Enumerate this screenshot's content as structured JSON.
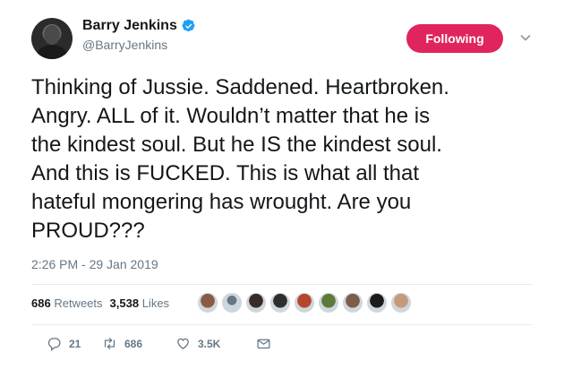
{
  "author": {
    "name": "Barry Jenkins",
    "handle": "@BarryJenkins",
    "verified_icon": "verified-badge-icon"
  },
  "follow_button": {
    "label": "Following",
    "color": "#e0245e"
  },
  "tweet": {
    "text": "Thinking of Jussie. Saddened. Heartbroken.\nAngry. ALL of it. Wouldn’t matter that he is\nthe kindest soul. But he IS the kindest soul.\nAnd this is FUCKED. This is what all that\nhateful mongering has wrought. Are you\nPROUD???",
    "timestamp": "2:26 PM - 29 Jan 2019"
  },
  "stats": {
    "retweets_count": "686",
    "retweets_label": "Retweets",
    "likes_count": "3,538",
    "likes_label": "Likes"
  },
  "liker_colors": [
    "#8a5a44",
    "#9aa5b1",
    "#3b2a2a",
    "#2e2e2e",
    "#b5472d",
    "#5d7a3a",
    "#7d5c4a",
    "#1c1c1c",
    "#c49a7a"
  ],
  "actions": {
    "reply_count": "21",
    "retweet_count": "686",
    "like_count": "3.5K"
  },
  "colors": {
    "text": "#14171a",
    "secondary": "#657786",
    "verified": "#1da1f2"
  }
}
